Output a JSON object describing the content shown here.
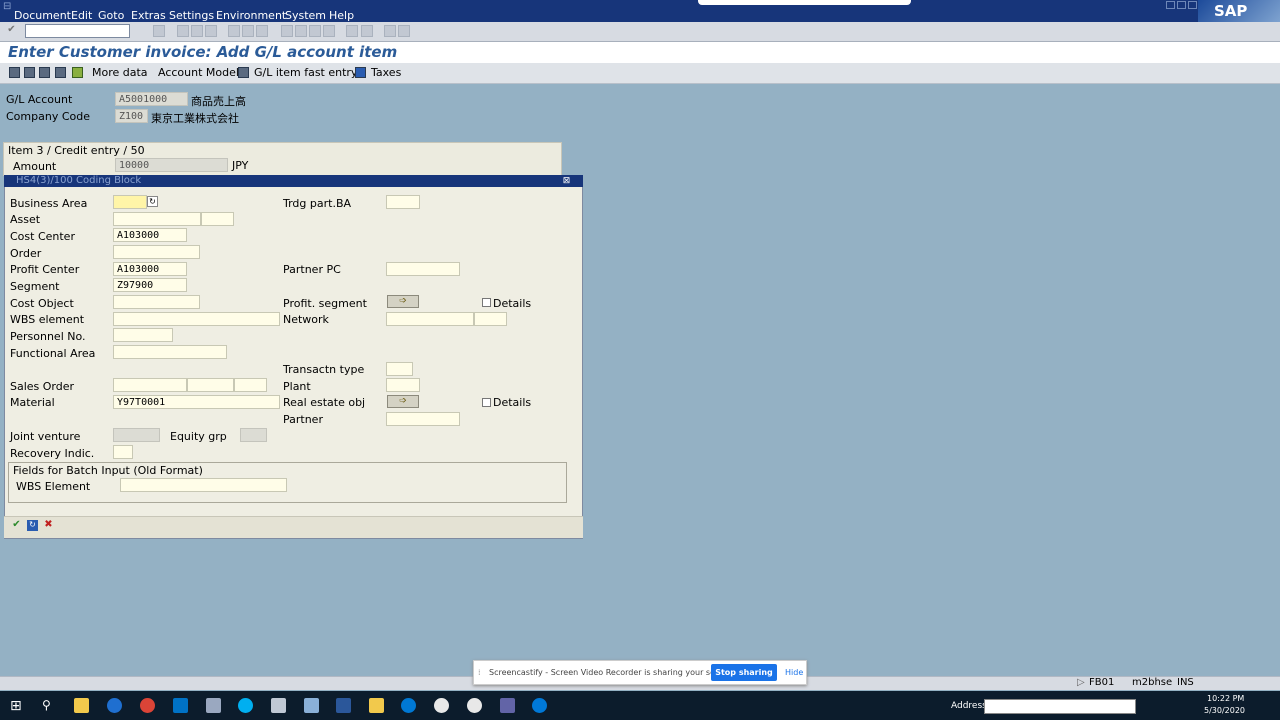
{
  "menu": {
    "items": [
      "Document",
      "Edit",
      "Goto",
      "Extras",
      "Settings",
      "Environment",
      "System",
      "Help"
    ],
    "logo": "SAP"
  },
  "header": {
    "title": "Enter Customer invoice: Add G/L account item"
  },
  "app_toolbar": {
    "more_data": "More data",
    "account_model": "Account Model",
    "gl_fast_entry": "G/L item fast entry",
    "taxes": "Taxes"
  },
  "top_fields": {
    "gl_account_label": "G/L Account",
    "gl_account_value": "A5001000",
    "gl_account_text": "商品売上高",
    "company_code_label": "Company Code",
    "company_code_value": "Z100",
    "company_code_text": "東京工業株式会社"
  },
  "item": {
    "header": "Item 3 / Credit entry / 50",
    "amount_label": "Amount",
    "amount_value": "10000",
    "currency": "JPY"
  },
  "coding_block": {
    "title": "HS4(3)/100 Coding Block",
    "business_area": "Business Area",
    "asset": "Asset",
    "cost_center": "Cost Center",
    "cost_center_value": "A103000",
    "order": "Order",
    "profit_center": "Profit Center",
    "profit_center_value": "A103000",
    "segment": "Segment",
    "segment_value": "Z97900",
    "cost_object": "Cost Object",
    "wbs_element": "WBS element",
    "personnel_no": "Personnel No.",
    "functional_area": "Functional Area",
    "sales_order": "Sales Order",
    "material": "Material",
    "material_value": "Y97T0001",
    "joint_venture": "Joint venture",
    "equity_grp": "Equity grp",
    "recovery_indic": "Recovery Indic.",
    "trdg_part_ba": "Trdg part.BA",
    "partner_pc": "Partner PC",
    "profit_segment": "Profit. segment",
    "network": "Network",
    "transactn_type": "Transactn type",
    "plant": "Plant",
    "real_estate_obj": "Real estate obj",
    "partner": "Partner",
    "details_1": "Details",
    "details_2": "Details",
    "batch_header": "Fields for Batch Input (Old Format)",
    "batch_wbs": "WBS Element"
  },
  "status_bar": {
    "tcode": "FB01",
    "server": "m2bhse",
    "mode": "INS"
  },
  "screencastify": {
    "message": "Screencastify - Screen Video Recorder is sharing your screen.",
    "stop": "Stop sharing",
    "hide": "Hide"
  },
  "taskbar": {
    "address_label": "Address",
    "time": "10:22 PM",
    "date": "5/30/2020"
  },
  "colors": {
    "menubar": "#17357a",
    "background": "#94b1c4",
    "title_text": "#2b5b98",
    "field_bg": "#fffde8",
    "stop_button": "#1a73e8"
  }
}
